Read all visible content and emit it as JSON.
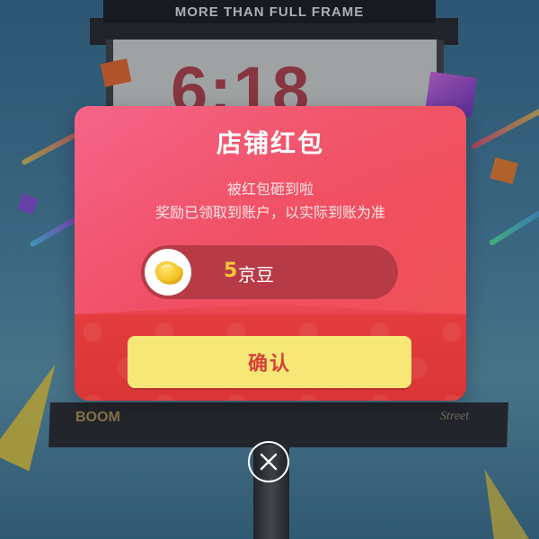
{
  "background": {
    "billboard_headline": "MORE THAN FULL FRAME",
    "billboard_number": "6:18",
    "billboard_footer_left": "BOOM",
    "billboard_footer_right": "Street"
  },
  "modal": {
    "title": "店铺红包",
    "subtitle": "被红包砸到啦",
    "note": "奖励已领取到账户，以实际到账为准",
    "reward": {
      "icon": "jingdou-bean-icon",
      "amount": "5",
      "unit": "京豆"
    },
    "confirm_label": "确认"
  },
  "close": {
    "icon": "close-icon"
  },
  "colors": {
    "modal_top": "#f4587f",
    "modal_bottom": "#ef5252",
    "confirm_bg": "#f6e777",
    "confirm_text": "#d7413a",
    "reward_amount": "#f7c93a"
  }
}
